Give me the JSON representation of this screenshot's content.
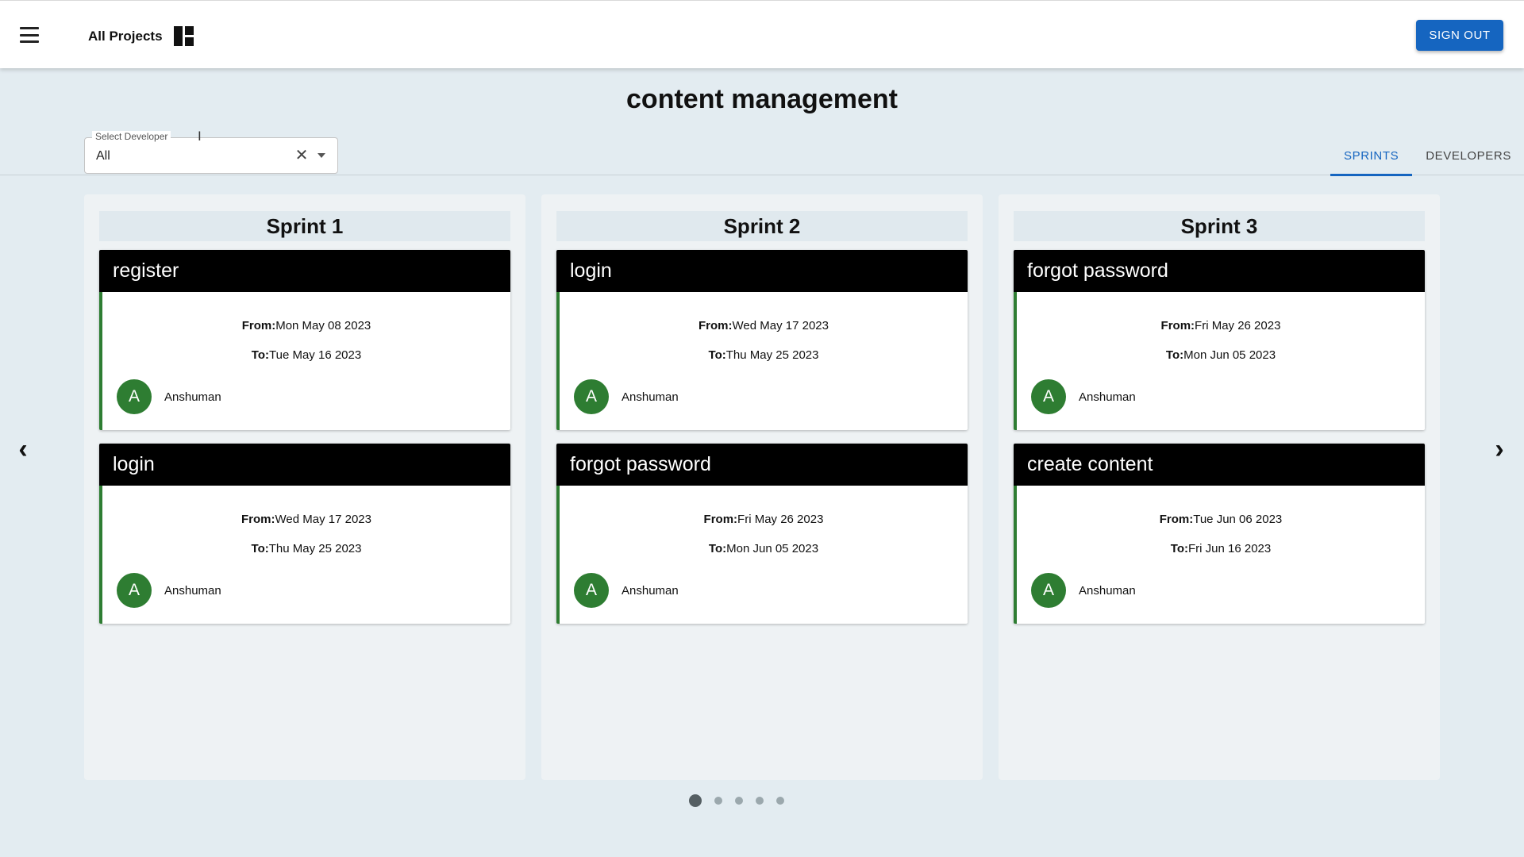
{
  "header": {
    "menu_icon": "hamburger-menu-icon",
    "projects_label": "All Projects",
    "projects_icon": "dashboard-icon",
    "signout_label": "SIGN OUT",
    "accent_color": "#1565c0"
  },
  "page": {
    "title": "content management"
  },
  "developer_select": {
    "label": "Select Developer",
    "value": "All",
    "clear_icon": "close-icon",
    "dropdown_icon": "caret-down-icon"
  },
  "tabs": [
    {
      "label": "SPRINTS",
      "active": true
    },
    {
      "label": "DEVELOPERS",
      "active": false
    }
  ],
  "carousel": {
    "prev_icon": "chevron-left-icon",
    "next_icon": "chevron-right-icon",
    "page_count": 5,
    "active_page": 1
  },
  "sprints": [
    {
      "title": "Sprint 1",
      "tasks": [
        {
          "name": "register",
          "from_label": "From:",
          "from": "Mon May 08 2023",
          "to_label": "To:",
          "to": "Tue May 16 2023",
          "avatar": "A",
          "developer": "Anshuman"
        },
        {
          "name": "login",
          "from_label": "From:",
          "from": "Wed May 17 2023",
          "to_label": "To:",
          "to": "Thu May 25 2023",
          "avatar": "A",
          "developer": "Anshuman"
        }
      ]
    },
    {
      "title": "Sprint 2",
      "tasks": [
        {
          "name": "login",
          "from_label": "From:",
          "from": "Wed May 17 2023",
          "to_label": "To:",
          "to": "Thu May 25 2023",
          "avatar": "A",
          "developer": "Anshuman"
        },
        {
          "name": "forgot password",
          "from_label": "From:",
          "from": "Fri May 26 2023",
          "to_label": "To:",
          "to": "Mon Jun 05 2023",
          "avatar": "A",
          "developer": "Anshuman"
        }
      ]
    },
    {
      "title": "Sprint 3",
      "tasks": [
        {
          "name": "forgot password",
          "from_label": "From:",
          "from": "Fri May 26 2023",
          "to_label": "To:",
          "to": "Mon Jun 05 2023",
          "avatar": "A",
          "developer": "Anshuman"
        },
        {
          "name": "create content",
          "from_label": "From:",
          "from": "Tue Jun 06 2023",
          "to_label": "To:",
          "to": "Fri Jun 16 2023",
          "avatar": "A",
          "developer": "Anshuman"
        }
      ]
    }
  ],
  "colors": {
    "avatar_bg": "#2e7d32",
    "card_accent": "#2e7d32",
    "task_header_bg": "#000000"
  }
}
